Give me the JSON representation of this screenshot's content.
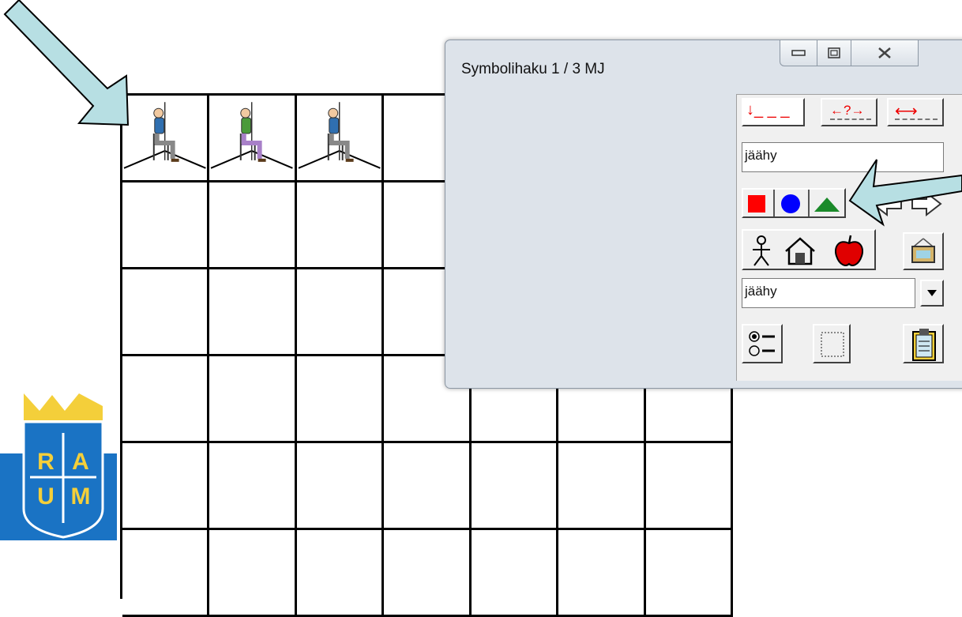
{
  "dialog": {
    "title": "Symbolihaku  1 / 3   MJ",
    "search_field": "jäähy",
    "category_select": "jäähy",
    "dash_buttons": [
      "↓_ _ _",
      "←?→",
      "⟷"
    ]
  },
  "grid": {
    "rows": 6,
    "columns": 7,
    "symbols": [
      "person-sitting-icon",
      "person-sitting-icon",
      "person-sitting-icon"
    ]
  },
  "logo": {
    "letters": [
      "R",
      "A",
      "U",
      "M"
    ]
  },
  "colors": {
    "arrow_fill": "#b7dfe3",
    "logo_blue": "#1a73c4",
    "logo_gold": "#f4cf3a"
  }
}
